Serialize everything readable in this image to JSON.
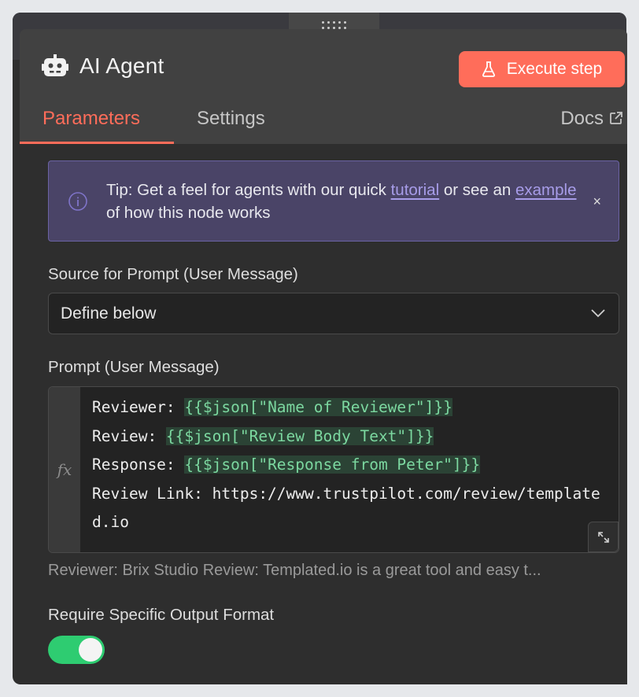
{
  "node": {
    "title": "AI Agent",
    "execute_label": "Execute step"
  },
  "tabs": [
    {
      "label": "Parameters",
      "active": true
    },
    {
      "label": "Settings",
      "active": false
    }
  ],
  "docs_label": "Docs",
  "tip": {
    "prefix": "Tip: Get a feel for agents with our quick ",
    "link1": "tutorial",
    "middle": " or see an ",
    "link2": "example",
    "suffix": " of how this node works",
    "close": "×"
  },
  "source": {
    "label": "Source for Prompt (User Message)",
    "value": "Define below"
  },
  "prompt": {
    "label": "Prompt (User Message)",
    "fx": "fx",
    "lines": [
      {
        "key": "Reviewer: ",
        "expr": "{{$json[\"Name of Reviewer\"]}}"
      },
      {
        "key": "Review: ",
        "expr": "{{$json[\"Review Body Text\"]}}"
      },
      {
        "key": "Response: ",
        "expr": "{{$json[\"Response from Peter\"]}}"
      },
      {
        "key": "Review Link: https://www.trustpilot.com/review/templated.io",
        "expr": ""
      }
    ],
    "preview": "Reviewer: Brix Studio Review: Templated.io is a great tool and easy t..."
  },
  "output_format": {
    "label": "Require Specific Output Format",
    "enabled": true
  },
  "colors": {
    "accent": "#ff6d5a",
    "toggle_on": "#2ecc71",
    "expression": "#7cd8a0",
    "tip_link": "#a79ce8"
  }
}
